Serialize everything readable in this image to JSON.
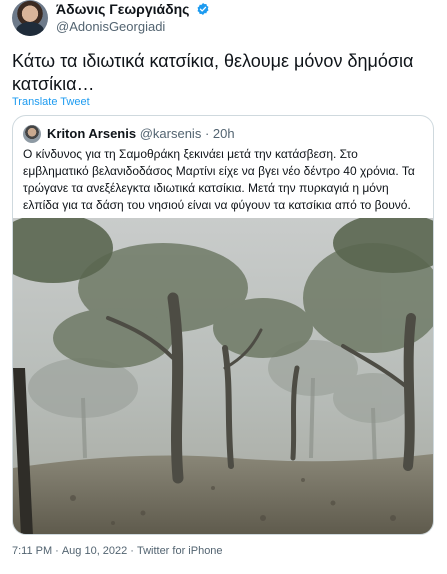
{
  "author": {
    "display_name": "Άδωνις Γεωργιάδης",
    "handle": "@AdonisGeorgiadi"
  },
  "tweet": {
    "text": "Κάτω τα ιδιωτικά κατσίκια, θελουμε μόνον δημόσια κατσίκια…",
    "translate_label": "Translate Tweet"
  },
  "quoted_tweet": {
    "display_name": "Kriton Arsenis",
    "handle": "@karsenis",
    "separator": "·",
    "time_ago": "20h",
    "text": "Ο κίνδυνος για τη Σαμοθράκη ξεκινάει μετά την κατάσβεση. Στο εμβληματικό βελανιδοδάσος Μαρτίνι είχε να βγει νέο δέντρο 40 χρόνια. Τα τρώγανε τα ανεξέλεγκτα ιδιωτικά κατσίκια. Μετά την πυρκαγιά η μόνη ελπίδα για τα δάση του νησιού είναι να φύγουν τα κατσίκια από το βουνό."
  },
  "footer": {
    "time": "7:11 PM",
    "separator": "·",
    "date": "Aug 10, 2022",
    "source": "Twitter for iPhone"
  },
  "colors": {
    "accent": "#1d9bf0",
    "secondary_text": "#536471",
    "border": "#cfd9de"
  }
}
